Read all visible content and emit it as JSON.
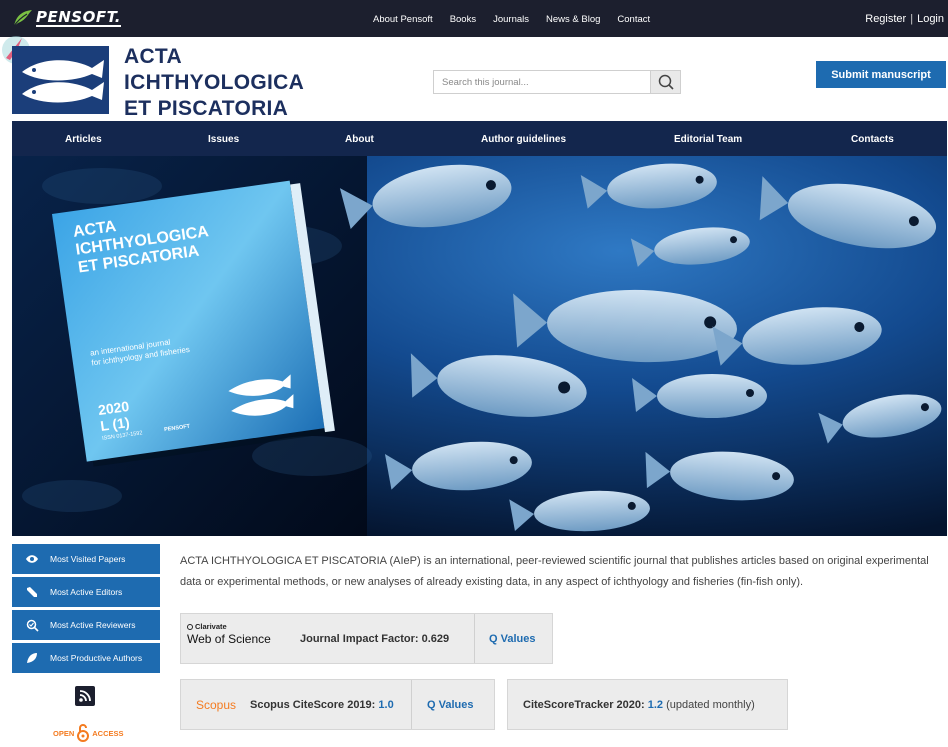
{
  "topbar": {
    "logo_text": "PENSOFT.",
    "nav": [
      "About Pensoft",
      "Books",
      "Journals",
      "News & Blog",
      "Contact"
    ],
    "register": "Register",
    "login": "Login"
  },
  "header": {
    "title_lines": [
      "ACTA",
      "ICHTHYOLOGICA",
      "ET PISCATORIA"
    ],
    "search_placeholder": "Search this journal...",
    "submit_label": "Submit manuscript"
  },
  "mainnav": [
    "Articles",
    "Issues",
    "About",
    "Author guidelines",
    "Editorial Team",
    "Contacts"
  ],
  "hero": {
    "cover_title": [
      "ACTA",
      "ICHTHYOLOGICA",
      "ET PISCATORIA"
    ],
    "cover_subtitle": [
      "an international journal",
      "for ichthyology and fisheries"
    ],
    "cover_year": "2020",
    "cover_volume": "L (1)",
    "cover_issn": "ISSN 0137-1592",
    "cover_publisher": "PENSOFT"
  },
  "sidebar": {
    "items": [
      {
        "label": "Most Visited Papers",
        "icon": "eye-icon"
      },
      {
        "label": "Most Active Editors",
        "icon": "pen-icon"
      },
      {
        "label": "Most Active Reviewers",
        "icon": "magnifier-check-icon"
      },
      {
        "label": "Most Productive Authors",
        "icon": "leaf-icon"
      }
    ],
    "oa_left": "OPEN",
    "oa_right": "ACCESS"
  },
  "content": {
    "description": "ACTA ICHTHYOLOGICA ET PISCATORIA (AIeP) is an international, peer-reviewed scientific journal that publishes articles based on original experimental data or experimental methods, or new analyses of already existing data, in any aspect of ichthyology and fisheries (fin-fish only).",
    "wos": {
      "brand_top": "Clarivate",
      "brand_main": "Web of Science",
      "label": "Journal Impact Factor: 0.629",
      "link": "Q Values"
    },
    "scopus": {
      "brand": "Scopus",
      "label": "Scopus CiteScore 2019:",
      "value": "1.0",
      "link": "Q Values"
    },
    "tracker": {
      "label": "CiteScoreTracker 2020:",
      "value": "1.2",
      "note": "(updated monthly)"
    }
  },
  "colors": {
    "topbar": "#1c1f2e",
    "navy": "#13264d",
    "accent": "#1e6bb0",
    "scopus_orange": "#f47b20"
  }
}
